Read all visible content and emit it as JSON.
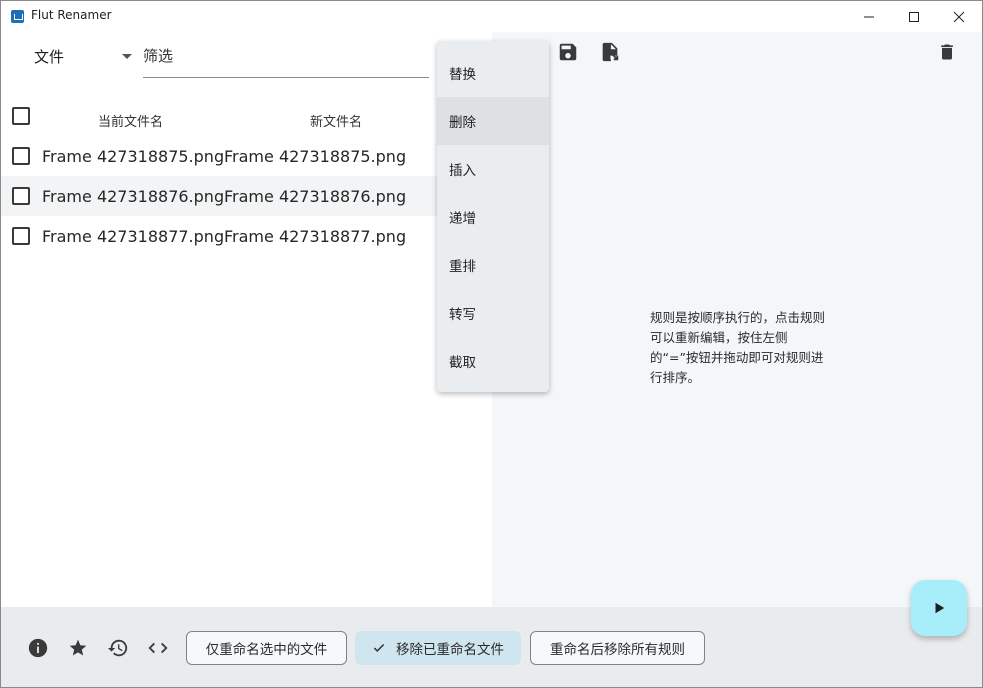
{
  "window": {
    "title": "Flut Renamer"
  },
  "toolbar": {
    "type_select_value": "文件",
    "filter_placeholder": "筛选"
  },
  "table": {
    "headers": [
      "当前文件名",
      "新文件名"
    ],
    "rows": [
      {
        "current": "Frame 427318875.png",
        "new": "Frame 427318875.png"
      },
      {
        "current": "Frame 427318876.png",
        "new": "Frame 427318876.png"
      },
      {
        "current": "Frame 427318877.png",
        "new": "Frame 427318877.png"
      }
    ]
  },
  "rule_menu": {
    "items": [
      "替换",
      "删除",
      "插入",
      "递增",
      "重排",
      "转写",
      "截取"
    ],
    "hovered_index": 1
  },
  "rules_panel": {
    "hint": "规则是按顺序执行的，点击规则可以重新编辑，按住左侧的“=”按钮并拖动即可对规则进行排序。"
  },
  "bottom_bar": {
    "icons": [
      "info-icon",
      "star-icon",
      "history-icon",
      "code-icon"
    ],
    "chips": {
      "rename_selected_only": "仅重命名选中的文件",
      "remove_renamed": "移除已重命名文件",
      "remove_rules_after_rename": "重命名后移除所有规则"
    }
  },
  "colors": {
    "accent_fab": "#a8eefa",
    "selected_chip": "#cfe6ee",
    "right_pane_bg": "#f3f7fa",
    "bottom_bar_bg": "#e8ecef"
  }
}
